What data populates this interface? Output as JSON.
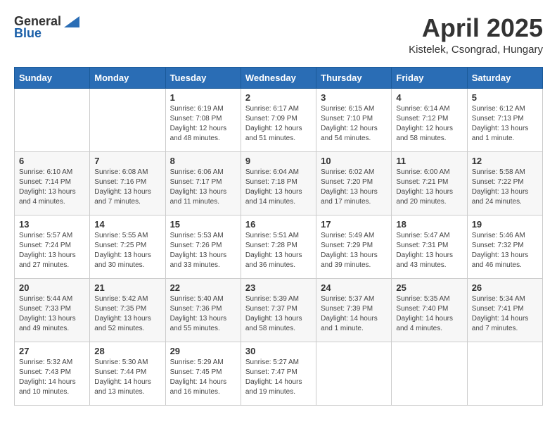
{
  "logo": {
    "general": "General",
    "blue": "Blue"
  },
  "header": {
    "title": "April 2025",
    "location": "Kistelek, Csongrad, Hungary"
  },
  "weekdays": [
    "Sunday",
    "Monday",
    "Tuesday",
    "Wednesday",
    "Thursday",
    "Friday",
    "Saturday"
  ],
  "weeks": [
    [
      {
        "day": "",
        "info": ""
      },
      {
        "day": "",
        "info": ""
      },
      {
        "day": "1",
        "info": "Sunrise: 6:19 AM\nSunset: 7:08 PM\nDaylight: 12 hours and 48 minutes."
      },
      {
        "day": "2",
        "info": "Sunrise: 6:17 AM\nSunset: 7:09 PM\nDaylight: 12 hours and 51 minutes."
      },
      {
        "day": "3",
        "info": "Sunrise: 6:15 AM\nSunset: 7:10 PM\nDaylight: 12 hours and 54 minutes."
      },
      {
        "day": "4",
        "info": "Sunrise: 6:14 AM\nSunset: 7:12 PM\nDaylight: 12 hours and 58 minutes."
      },
      {
        "day": "5",
        "info": "Sunrise: 6:12 AM\nSunset: 7:13 PM\nDaylight: 13 hours and 1 minute."
      }
    ],
    [
      {
        "day": "6",
        "info": "Sunrise: 6:10 AM\nSunset: 7:14 PM\nDaylight: 13 hours and 4 minutes."
      },
      {
        "day": "7",
        "info": "Sunrise: 6:08 AM\nSunset: 7:16 PM\nDaylight: 13 hours and 7 minutes."
      },
      {
        "day": "8",
        "info": "Sunrise: 6:06 AM\nSunset: 7:17 PM\nDaylight: 13 hours and 11 minutes."
      },
      {
        "day": "9",
        "info": "Sunrise: 6:04 AM\nSunset: 7:18 PM\nDaylight: 13 hours and 14 minutes."
      },
      {
        "day": "10",
        "info": "Sunrise: 6:02 AM\nSunset: 7:20 PM\nDaylight: 13 hours and 17 minutes."
      },
      {
        "day": "11",
        "info": "Sunrise: 6:00 AM\nSunset: 7:21 PM\nDaylight: 13 hours and 20 minutes."
      },
      {
        "day": "12",
        "info": "Sunrise: 5:58 AM\nSunset: 7:22 PM\nDaylight: 13 hours and 24 minutes."
      }
    ],
    [
      {
        "day": "13",
        "info": "Sunrise: 5:57 AM\nSunset: 7:24 PM\nDaylight: 13 hours and 27 minutes."
      },
      {
        "day": "14",
        "info": "Sunrise: 5:55 AM\nSunset: 7:25 PM\nDaylight: 13 hours and 30 minutes."
      },
      {
        "day": "15",
        "info": "Sunrise: 5:53 AM\nSunset: 7:26 PM\nDaylight: 13 hours and 33 minutes."
      },
      {
        "day": "16",
        "info": "Sunrise: 5:51 AM\nSunset: 7:28 PM\nDaylight: 13 hours and 36 minutes."
      },
      {
        "day": "17",
        "info": "Sunrise: 5:49 AM\nSunset: 7:29 PM\nDaylight: 13 hours and 39 minutes."
      },
      {
        "day": "18",
        "info": "Sunrise: 5:47 AM\nSunset: 7:31 PM\nDaylight: 13 hours and 43 minutes."
      },
      {
        "day": "19",
        "info": "Sunrise: 5:46 AM\nSunset: 7:32 PM\nDaylight: 13 hours and 46 minutes."
      }
    ],
    [
      {
        "day": "20",
        "info": "Sunrise: 5:44 AM\nSunset: 7:33 PM\nDaylight: 13 hours and 49 minutes."
      },
      {
        "day": "21",
        "info": "Sunrise: 5:42 AM\nSunset: 7:35 PM\nDaylight: 13 hours and 52 minutes."
      },
      {
        "day": "22",
        "info": "Sunrise: 5:40 AM\nSunset: 7:36 PM\nDaylight: 13 hours and 55 minutes."
      },
      {
        "day": "23",
        "info": "Sunrise: 5:39 AM\nSunset: 7:37 PM\nDaylight: 13 hours and 58 minutes."
      },
      {
        "day": "24",
        "info": "Sunrise: 5:37 AM\nSunset: 7:39 PM\nDaylight: 14 hours and 1 minute."
      },
      {
        "day": "25",
        "info": "Sunrise: 5:35 AM\nSunset: 7:40 PM\nDaylight: 14 hours and 4 minutes."
      },
      {
        "day": "26",
        "info": "Sunrise: 5:34 AM\nSunset: 7:41 PM\nDaylight: 14 hours and 7 minutes."
      }
    ],
    [
      {
        "day": "27",
        "info": "Sunrise: 5:32 AM\nSunset: 7:43 PM\nDaylight: 14 hours and 10 minutes."
      },
      {
        "day": "28",
        "info": "Sunrise: 5:30 AM\nSunset: 7:44 PM\nDaylight: 14 hours and 13 minutes."
      },
      {
        "day": "29",
        "info": "Sunrise: 5:29 AM\nSunset: 7:45 PM\nDaylight: 14 hours and 16 minutes."
      },
      {
        "day": "30",
        "info": "Sunrise: 5:27 AM\nSunset: 7:47 PM\nDaylight: 14 hours and 19 minutes."
      },
      {
        "day": "",
        "info": ""
      },
      {
        "day": "",
        "info": ""
      },
      {
        "day": "",
        "info": ""
      }
    ]
  ]
}
